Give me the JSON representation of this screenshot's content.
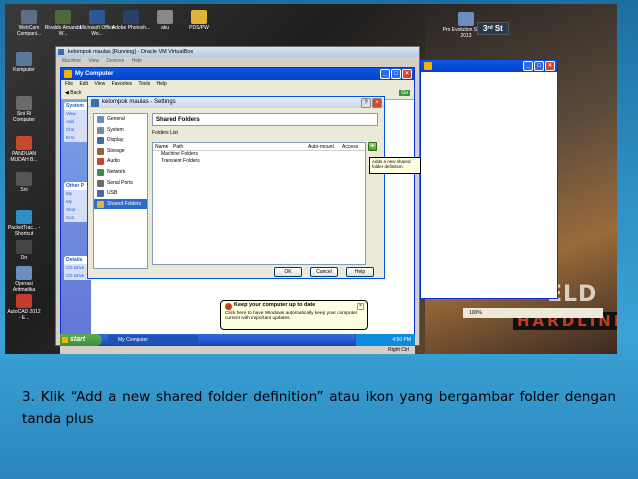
{
  "desktop_icons": [
    {
      "label": "WebCam Compani...",
      "color": "#5b6e8a"
    },
    {
      "label": "Rivaldo Amanda W...",
      "color": "#4a6b3b"
    },
    {
      "label": "Microsoft Office Wo...",
      "color": "#2b5797"
    },
    {
      "label": "Adobe Photosh...",
      "color": "#2c3e6b"
    },
    {
      "label": "aku",
      "color": "#888888"
    },
    {
      "label": "PDS/PW",
      "color": "#e2b33a"
    }
  ],
  "left_icons": [
    {
      "label": "Komputer",
      "color": "#5a7a9a"
    },
    {
      "label": "Sini Ri Computer",
      "color": "#6a6a6a"
    },
    {
      "label": "PANDUAN MUDAH B...",
      "color": "#c44a2b"
    },
    {
      "label": "Sni",
      "color": "#555555"
    },
    {
      "label": "PacketTrac... - Shortcut",
      "color": "#2f8fc4"
    },
    {
      "label": "Dn",
      "color": "#444444"
    },
    {
      "label": "Operasi Aritmatika",
      "color": "#6a8fbf"
    },
    {
      "label": "AutoCAD 2012 - E...",
      "color": "#c23b2b"
    }
  ],
  "top_right_icon": {
    "label": "Pro Evolution Soccer 2013"
  },
  "top_right_badge": "3ʳᵈ St",
  "vbox_window": {
    "title": "kelompok maulas [Running] - Oracle VM VirtualBox",
    "menu": "Machine View Devices Help",
    "status_right": "Right Ctrl"
  },
  "my_computer": {
    "title": "My Computer",
    "menu": "File Edit View Favorites Tools Help",
    "back_label": "Back",
    "go_label": "Go",
    "side_panels": [
      {
        "title": "System",
        "items": [
          "View",
          "Add",
          "Cha",
          "Erro"
        ]
      },
      {
        "title": "Other P",
        "items": [
          "My",
          "My",
          "Shar",
          "Con"
        ]
      },
      {
        "title": "Details",
        "items": [
          "CD Drive",
          "CD Drive"
        ]
      }
    ]
  },
  "settings_dialog": {
    "title": "kelompok maulas - Settings",
    "nav": [
      {
        "label": "General",
        "color": "#6a8fbf"
      },
      {
        "label": "System",
        "color": "#7a8a9a"
      },
      {
        "label": "Display",
        "color": "#3a6ea5"
      },
      {
        "label": "Storage",
        "color": "#8a6a3a"
      },
      {
        "label": "Audio",
        "color": "#c44a2b"
      },
      {
        "label": "Network",
        "color": "#3a8a4a"
      },
      {
        "label": "Serial Ports",
        "color": "#6a6a6a"
      },
      {
        "label": "USB",
        "color": "#4a6a9a"
      },
      {
        "label": "Shared Folders",
        "color": "#e2b33a"
      }
    ],
    "selected": "Shared Folders",
    "section_title": "Shared Folders",
    "list_label": "Folders List",
    "columns": [
      "Name",
      "Path",
      "Auto-mount",
      "Access"
    ],
    "rows": [
      "Machine Folders",
      "Transient Folders"
    ],
    "tooltip": "Adds a new shared folder definition.",
    "buttons": {
      "ok": "OK",
      "cancel": "Cancel",
      "help": "Help"
    }
  },
  "balloon": {
    "title": "Keep your computer up to date",
    "text": "Click here to have Windows automatically keep your computer current with important updates."
  },
  "taskbar": {
    "start": "start",
    "task": "My Computer",
    "clock": "4:50 PM"
  },
  "zoom": "100%",
  "game_art": {
    "big": "ELD",
    "hard": "HARDLINE"
  },
  "caption": "3. Klik “Add a new shared folder definition” atau ikon yang bergambar folder dengan tanda plus"
}
